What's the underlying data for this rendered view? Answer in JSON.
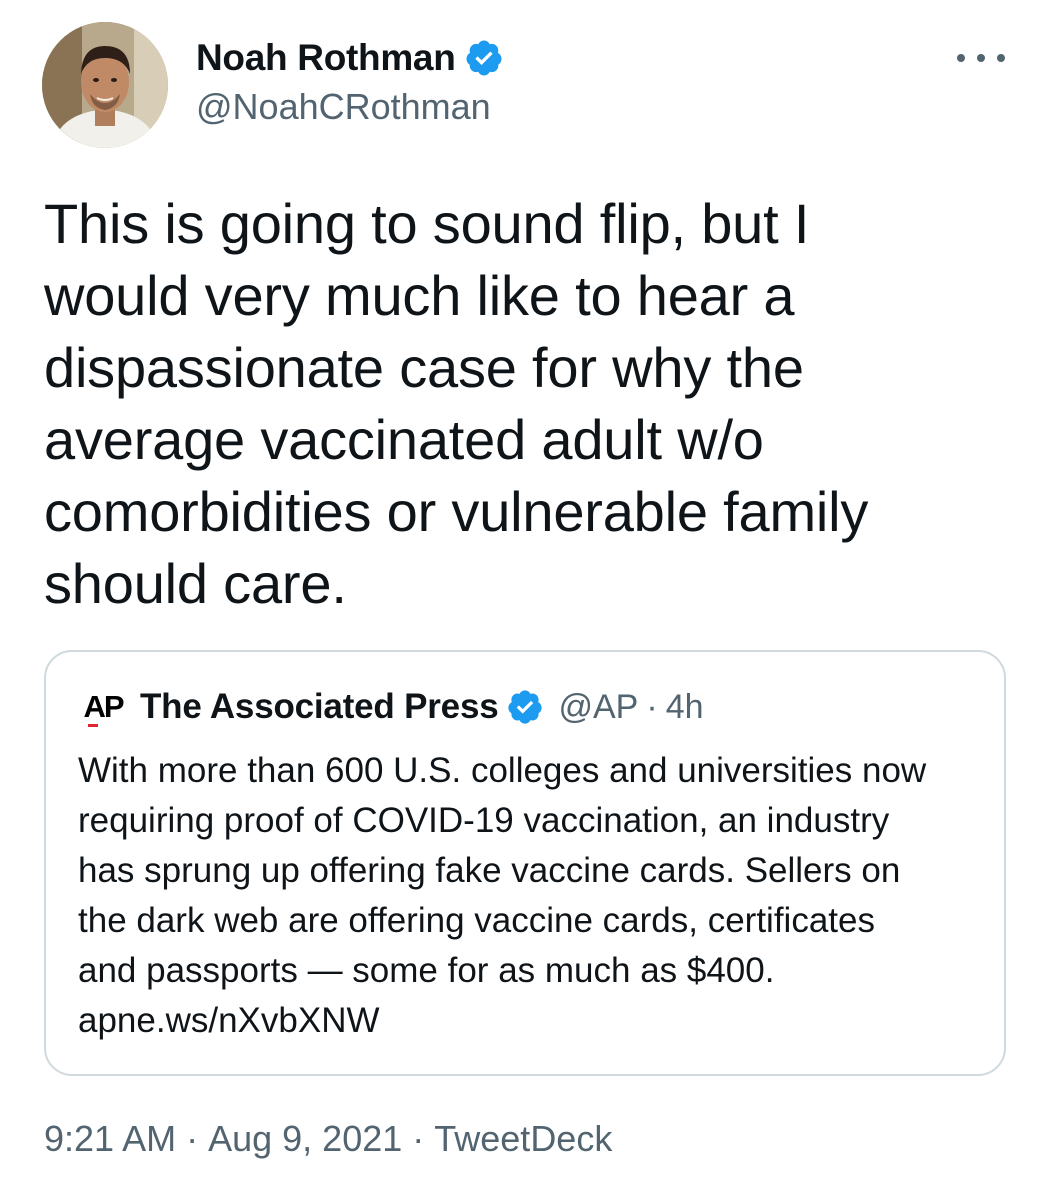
{
  "author": {
    "name": "Noah Rothman",
    "handle": "@NoahCRothman",
    "verified": true
  },
  "tweet": {
    "text_lines": [
      "This is going to sound flip, but I",
      "would very much like to hear a",
      "dispassionate case for why the",
      "average vaccinated adult w/o",
      "comorbidities or vulnerable family",
      "should care."
    ]
  },
  "quoted_tweet": {
    "logo_text": "AP",
    "name": "The Associated Press",
    "handle": "@AP",
    "separator": "·",
    "time": "4h",
    "text_lines": [
      "With more than 600 U.S. colleges and universities now",
      "requiring proof of COVID-19 vaccination, an industry",
      "has sprung up offering fake vaccine cards. Sellers on",
      "the dark web are offering vaccine cards, certificates",
      "and passports — some for as much as $400."
    ],
    "link": "apne.ws/nXvbXNW"
  },
  "meta": {
    "time": "9:21 AM",
    "separator": "·",
    "date": "Aug 9, 2021",
    "source": "TweetDeck"
  },
  "icons": {
    "verified": "verified-badge-icon",
    "more": "more-options-icon"
  },
  "colors": {
    "verified_blue": "#1d9bf0",
    "secondary_text": "#536471",
    "border": "#cfd9de"
  }
}
